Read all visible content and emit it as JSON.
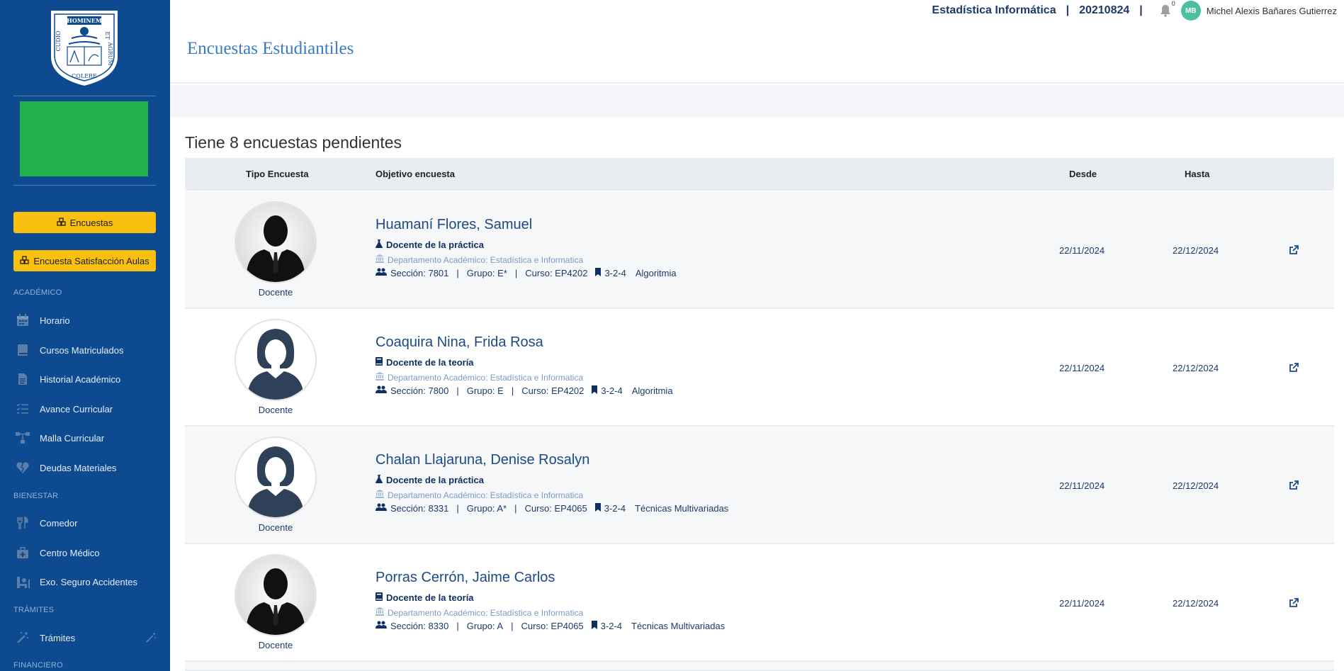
{
  "sidebar": {
    "logo_text": {
      "top": "HOMINEM",
      "right": "ET",
      "side": "AGRUM",
      "left": "CUDIO",
      "bottom": "COLERE"
    },
    "btn_encuestas": "Encuestas",
    "btn_satisfaccion": "Encuesta Satisfacción Aulas",
    "section_academico": "ACADÉMICO",
    "section_bienestar": "BIENESTAR",
    "section_tramites": "TRÁMITES",
    "section_financiero": "FINANCIERO",
    "items": [
      {
        "label": "Horario",
        "icon": "calendar-icon"
      },
      {
        "label": "Cursos Matriculados",
        "icon": "book-icon"
      },
      {
        "label": "Historial Académico",
        "icon": "file-icon"
      },
      {
        "label": "Avance Curricular",
        "icon": "checklist-icon"
      },
      {
        "label": "Malla Curricular",
        "icon": "sitemap-icon"
      },
      {
        "label": "Deudas Materiales",
        "icon": "broken-heart-icon"
      },
      {
        "label": "Comedor",
        "icon": "utensils-icon"
      },
      {
        "label": "Centro Médico",
        "icon": "medkit-icon"
      },
      {
        "label": "Exo. Seguro Accidentes",
        "icon": "wheelchair-icon"
      },
      {
        "label": "Trámites",
        "icon": "magic-wand-icon"
      }
    ]
  },
  "header": {
    "title": "Encuestas Estudiantiles",
    "career": "Estadística Informática",
    "code": "20210824",
    "notifications": "0",
    "avatar_initials": "MB",
    "user_name": "Michel Alexis Bañares Gutierrez"
  },
  "main": {
    "pending_title": "Tiene 8 encuestas pendientes",
    "columns": {
      "tipo": "Tipo Encuesta",
      "objetivo": "Objetivo encuesta",
      "desde": "Desde",
      "hasta": "Hasta"
    },
    "rows": [
      {
        "photo": "male",
        "label": "Docente",
        "name": "Huamaní Flores, Samuel",
        "role": "Docente de la práctica",
        "role_icon": "flask-icon",
        "dept": "Departamento Académico: Estadística e Informatica",
        "seccion": "Sección: 7801",
        "grupo": "Grupo: E*",
        "curso": "Curso: EP4202",
        "cred": "3-2-4",
        "course_name": "Algoritmia",
        "desde": "22/11/2024",
        "hasta": "22/12/2024"
      },
      {
        "photo": "female",
        "label": "Docente",
        "name": "Coaquira Nina, Frida Rosa",
        "role": "Docente de la teoría",
        "role_icon": "book-icon",
        "dept": "Departamento Académico: Estadística e Informatica",
        "seccion": "Sección: 7800",
        "grupo": "Grupo: E",
        "curso": "Curso: EP4202",
        "cred": "3-2-4",
        "course_name": "Algoritmia",
        "desde": "22/11/2024",
        "hasta": "22/12/2024"
      },
      {
        "photo": "female",
        "label": "Docente",
        "name": "Chalan Llajaruna, Denise Rosalyn",
        "role": "Docente de la práctica",
        "role_icon": "flask-icon",
        "dept": "Departamento Académico: Estadística e Informatica",
        "seccion": "Sección: 8331",
        "grupo": "Grupo: A*",
        "curso": "Curso: EP4065",
        "cred": "3-2-4",
        "course_name": "Técnicas Multivariadas",
        "desde": "22/11/2024",
        "hasta": "22/12/2024"
      },
      {
        "photo": "male",
        "label": "Docente",
        "name": "Porras Cerrón, Jaime Carlos",
        "role": "Docente de la teoría",
        "role_icon": "book-icon",
        "dept": "Departamento Académico: Estadística e Informatica",
        "seccion": "Sección: 8330",
        "grupo": "Grupo: A",
        "curso": "Curso: EP4065",
        "cred": "3-2-4",
        "course_name": "Técnicas Multivariadas",
        "desde": "22/11/2024",
        "hasta": "22/12/2024"
      }
    ]
  }
}
